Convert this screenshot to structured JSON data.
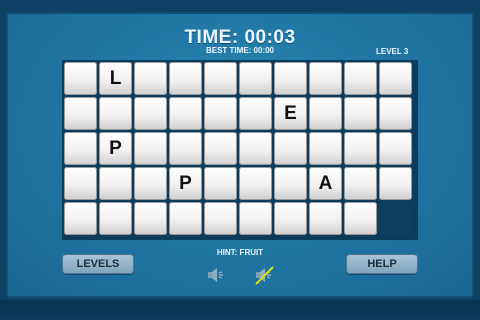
{
  "header": {
    "time": "TIME: 00:03",
    "best_time": "BEST TIME: 00:00",
    "level": "LEVEL 3"
  },
  "board": {
    "rows": [
      [
        "",
        "L",
        "",
        "",
        "",
        "",
        "",
        "",
        "",
        ""
      ],
      [
        "",
        "",
        "",
        "",
        "",
        "",
        "E",
        "",
        "",
        ""
      ],
      [
        "",
        "P",
        "",
        "",
        "",
        "",
        "",
        "",
        "",
        ""
      ],
      [
        "",
        "",
        "",
        "P",
        "",
        "",
        "",
        "A",
        "",
        ""
      ],
      [
        "",
        "",
        "",
        "",
        "",
        "",
        "",
        "",
        "",
        "#"
      ]
    ]
  },
  "hint": "HINT: FRUIT",
  "buttons": {
    "levels": "LEVELS",
    "help": "HELP"
  },
  "icons": {
    "sound": "speaker-icon",
    "music": "music-muted-icon"
  },
  "colors": {
    "panel": "#1f73a0",
    "text": "#eaf6ff",
    "strike": "#d6e21a"
  }
}
